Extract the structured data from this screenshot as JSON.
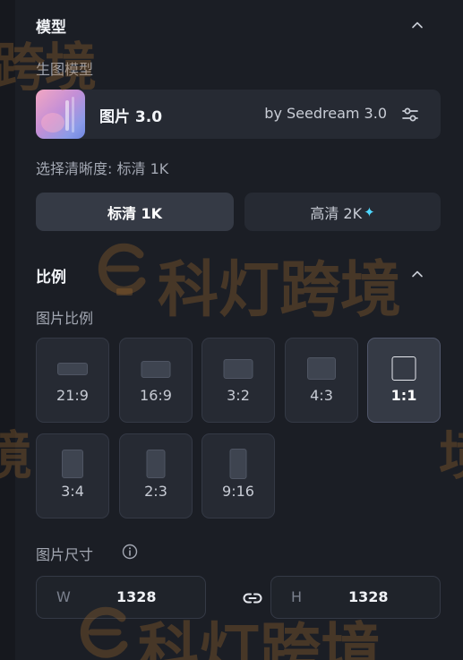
{
  "model_section": {
    "title": "模型",
    "subtitle": "生图模型",
    "model_name": "图片 3.0",
    "model_by": "by Seedream 3.0",
    "resolution_label": "选择清晰度: 标清 1K",
    "resolution_options": [
      {
        "label": "标清 1K",
        "selected": true
      },
      {
        "label": "高清 2K",
        "selected": false
      }
    ]
  },
  "ratio_section": {
    "title": "比例",
    "subtitle": "图片比例",
    "options": [
      {
        "label": "21:9",
        "selected": false
      },
      {
        "label": "16:9",
        "selected": false
      },
      {
        "label": "3:2",
        "selected": false
      },
      {
        "label": "4:3",
        "selected": false
      },
      {
        "label": "1:1",
        "selected": true
      },
      {
        "label": "3:4",
        "selected": false
      },
      {
        "label": "2:3",
        "selected": false
      },
      {
        "label": "9:16",
        "selected": false
      }
    ]
  },
  "size_section": {
    "title": "图片尺寸",
    "width_prefix": "W",
    "width_value": "1328",
    "height_prefix": "H",
    "height_value": "1328"
  },
  "watermark": {
    "text": "科灯跨境",
    "fragment_top": "跨境",
    "fragment_mid": "境"
  },
  "colors": {
    "accent_sparkle": "#4fd8ff",
    "panel_bg": "#1b1e25",
    "card_bg": "#262a33"
  }
}
